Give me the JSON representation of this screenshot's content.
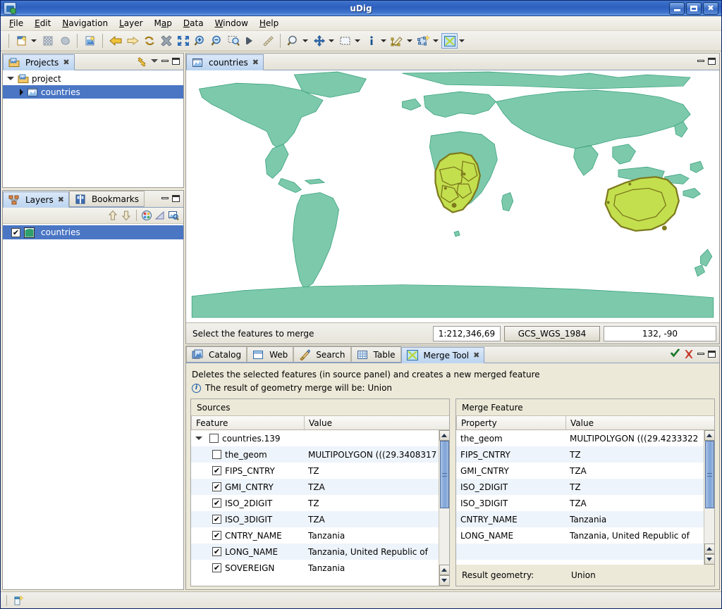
{
  "window": {
    "title": "uDig",
    "icon": "udig-app-icon",
    "controls": [
      {
        "name": "minimize-button",
        "glyph": "minimize"
      },
      {
        "name": "maximize-button",
        "glyph": "maximize"
      },
      {
        "name": "close-button",
        "glyph": "close"
      }
    ]
  },
  "menubar": {
    "items": [
      {
        "label": "File",
        "mnemonic": "F"
      },
      {
        "label": "Edit",
        "mnemonic": "E"
      },
      {
        "label": "Navigation",
        "mnemonic": "N"
      },
      {
        "label": "Layer",
        "mnemonic": "L"
      },
      {
        "label": "Map",
        "mnemonic": "M"
      },
      {
        "label": "Data",
        "mnemonic": "D"
      },
      {
        "label": "Window",
        "mnemonic": "W"
      },
      {
        "label": "Help",
        "mnemonic": "H"
      }
    ]
  },
  "toolbar": {
    "items": [
      {
        "name": "new-map-button",
        "icon": "new-document-icon",
        "dropdown": true
      },
      {
        "name": "copy-grid-button",
        "icon": "checker-grid-icon",
        "dropdown": false
      },
      {
        "name": "paste-blob-button",
        "icon": "blob-icon",
        "dropdown": false
      },
      {
        "name": "separator",
        "icon": "separator",
        "dropdown": false
      },
      {
        "name": "new-layer-button",
        "icon": "new-layer-icon",
        "dropdown": false
      },
      {
        "name": "separator",
        "icon": "separator",
        "dropdown": false
      },
      {
        "name": "back-button",
        "icon": "arrow-left-icon",
        "dropdown": false
      },
      {
        "name": "forward-button",
        "icon": "arrow-right-icon",
        "dropdown": false
      },
      {
        "name": "refresh-button",
        "icon": "refresh-icon",
        "dropdown": false
      },
      {
        "name": "stop-button",
        "icon": "stop-star-icon",
        "dropdown": false
      },
      {
        "name": "zoom-extent-button",
        "icon": "zoom-extent-icon",
        "dropdown": false
      },
      {
        "name": "zoom-in-button",
        "icon": "zoom-in-icon",
        "dropdown": false
      },
      {
        "name": "zoom-out-button",
        "icon": "zoom-out-icon",
        "dropdown": false
      },
      {
        "name": "zoom-selection-button",
        "icon": "zoom-selection-icon",
        "dropdown": false
      },
      {
        "name": "pan-to-button",
        "icon": "solid-arrow-icon",
        "dropdown": false
      },
      {
        "name": "measure-button",
        "icon": "ruler-icon",
        "dropdown": false
      },
      {
        "name": "separator",
        "icon": "separator",
        "dropdown": false
      },
      {
        "name": "zoom-tool-button",
        "icon": "magnifier-icon",
        "dropdown": true
      },
      {
        "name": "pan-tool-button",
        "icon": "move-cross-icon",
        "dropdown": true
      },
      {
        "name": "select-tool-button",
        "icon": "marquee-select-icon",
        "dropdown": true
      },
      {
        "name": "info-tool-button",
        "icon": "info-i-icon",
        "dropdown": true
      },
      {
        "name": "edit-geometry-button",
        "icon": "edit-pencil-icon",
        "dropdown": true
      },
      {
        "name": "create-feature-button",
        "icon": "create-polygon-icon",
        "dropdown": true
      },
      {
        "name": "merge-tool-button",
        "icon": "merge-x-icon",
        "dropdown": true,
        "active": true
      }
    ]
  },
  "projects_view": {
    "tab": {
      "label": "Projects",
      "icon": "projects-icon",
      "close": "✖"
    },
    "tools": [
      {
        "name": "link-with-editor-button",
        "icon": "link-icon"
      },
      {
        "name": "view-menu-button",
        "icon": "chevron-down-icon"
      },
      {
        "name": "minimize-button",
        "icon": "minimize-icon"
      },
      {
        "name": "maximize-button",
        "icon": "maximize-icon"
      }
    ],
    "tree": [
      {
        "label": "project",
        "icon": "project-folder-icon",
        "expanded": true,
        "indent": 0,
        "selected": false
      },
      {
        "label": "countries",
        "icon": "map-icon",
        "expanded": false,
        "indent": 1,
        "selected": true
      }
    ]
  },
  "layers_view": {
    "tabs": [
      {
        "label": "Layers",
        "icon": "layers-icon",
        "active": true,
        "close": "✖"
      },
      {
        "label": "Bookmarks",
        "icon": "bookmarks-icon",
        "active": false,
        "close": ""
      }
    ],
    "tools": [
      {
        "name": "minimize-button",
        "icon": "minimize-icon"
      },
      {
        "name": "maximize-button",
        "icon": "maximize-icon"
      }
    ],
    "toolbar": [
      {
        "name": "move-layer-up-button",
        "icon": "arrow-up-icon"
      },
      {
        "name": "move-layer-down-button",
        "icon": "arrow-down-icon"
      },
      {
        "name": "separator",
        "icon": "separator"
      },
      {
        "name": "style-editor-button",
        "icon": "color-palette-icon"
      },
      {
        "name": "transparency-button",
        "icon": "opacity-triangle-icon"
      },
      {
        "name": "zoom-to-layer-button",
        "icon": "zoom-layer-icon"
      }
    ],
    "layers": [
      {
        "label": "countries",
        "checked": true,
        "icon": "layer-polygon-icon",
        "selected": true
      }
    ]
  },
  "map_editor": {
    "tab": {
      "label": "countries",
      "icon": "map-icon",
      "close": "✖"
    },
    "tools": [
      {
        "name": "minimize-button",
        "icon": "minimize-icon"
      },
      {
        "name": "maximize-button",
        "icon": "maximize-icon"
      }
    ],
    "status": {
      "message": "Select the features to merge",
      "scale": "1:212,346,69",
      "crs": "GCS_WGS_1984",
      "coordinates": "132, -90"
    },
    "colors": {
      "land": "#7dc9ab",
      "land_stroke": "#2f9c77",
      "selection_fill": "#c3df4e",
      "selection_stroke": "#7d7a1d",
      "background": "#ffffff"
    }
  },
  "bottom_panel": {
    "tabs": [
      {
        "label": "Catalog",
        "icon": "catalog-icon",
        "active": false,
        "close": ""
      },
      {
        "label": "Web",
        "icon": "web-icon",
        "active": false,
        "close": ""
      },
      {
        "label": "Search",
        "icon": "search-icon",
        "active": false,
        "close": ""
      },
      {
        "label": "Table",
        "icon": "table-icon",
        "active": false,
        "close": ""
      },
      {
        "label": "Merge Tool",
        "icon": "merge-x-icon",
        "active": true,
        "close": "✖"
      }
    ],
    "tools": [
      {
        "name": "apply-merge-button",
        "icon": "green-check-icon"
      },
      {
        "name": "cancel-merge-button",
        "icon": "red-x-icon"
      },
      {
        "name": "minimize-button",
        "icon": "minimize-icon"
      },
      {
        "name": "maximize-button",
        "icon": "maximize-icon"
      }
    ]
  },
  "merge_tool": {
    "description": "Deletes the selected features (in source panel) and creates a new merged feature",
    "info_message": "The result of geometry merge will be: Union",
    "info_icon": "info-circle-icon",
    "sources": {
      "title": "Sources",
      "columns": [
        "Feature",
        "Value"
      ],
      "rows": [
        {
          "indent": 0,
          "twisty": "open",
          "checkbox": "unchecked",
          "feature": "countries.139",
          "value": ""
        },
        {
          "indent": 1,
          "twisty": "none",
          "checkbox": "unchecked",
          "feature": "the_geom",
          "value": "MULTIPOLYGON (((29.3408317"
        },
        {
          "indent": 1,
          "twisty": "none",
          "checkbox": "checked",
          "feature": "FIPS_CNTRY",
          "value": "TZ"
        },
        {
          "indent": 1,
          "twisty": "none",
          "checkbox": "checked",
          "feature": "GMI_CNTRY",
          "value": "TZA"
        },
        {
          "indent": 1,
          "twisty": "none",
          "checkbox": "checked",
          "feature": "ISO_2DIGIT",
          "value": "TZ"
        },
        {
          "indent": 1,
          "twisty": "none",
          "checkbox": "checked",
          "feature": "ISO_3DIGIT",
          "value": "TZA"
        },
        {
          "indent": 1,
          "twisty": "none",
          "checkbox": "checked",
          "feature": "CNTRY_NAME",
          "value": "Tanzania"
        },
        {
          "indent": 1,
          "twisty": "none",
          "checkbox": "checked",
          "feature": "LONG_NAME",
          "value": "Tanzania, United Republic of"
        },
        {
          "indent": 1,
          "twisty": "none",
          "checkbox": "checked",
          "feature": "SOVEREIGN",
          "value": "Tanzania"
        }
      ]
    },
    "merge_feature": {
      "title": "Merge Feature",
      "columns": [
        "Property",
        "Value"
      ],
      "rows": [
        {
          "property": "the_geom",
          "value": "MULTIPOLYGON (((29.4233322"
        },
        {
          "property": "FIPS_CNTRY",
          "value": "TZ"
        },
        {
          "property": "GMI_CNTRY",
          "value": "TZA"
        },
        {
          "property": "ISO_2DIGIT",
          "value": "TZ"
        },
        {
          "property": "ISO_3DIGIT",
          "value": "TZA"
        },
        {
          "property": "CNTRY_NAME",
          "value": "Tanzania"
        },
        {
          "property": "LONG_NAME",
          "value": "Tanzania, United Republic of"
        }
      ],
      "result_label": "Result geometry:",
      "result_value": "Union"
    }
  },
  "bottom_status": {
    "icon": "edit-mode-icon",
    "text": ""
  }
}
